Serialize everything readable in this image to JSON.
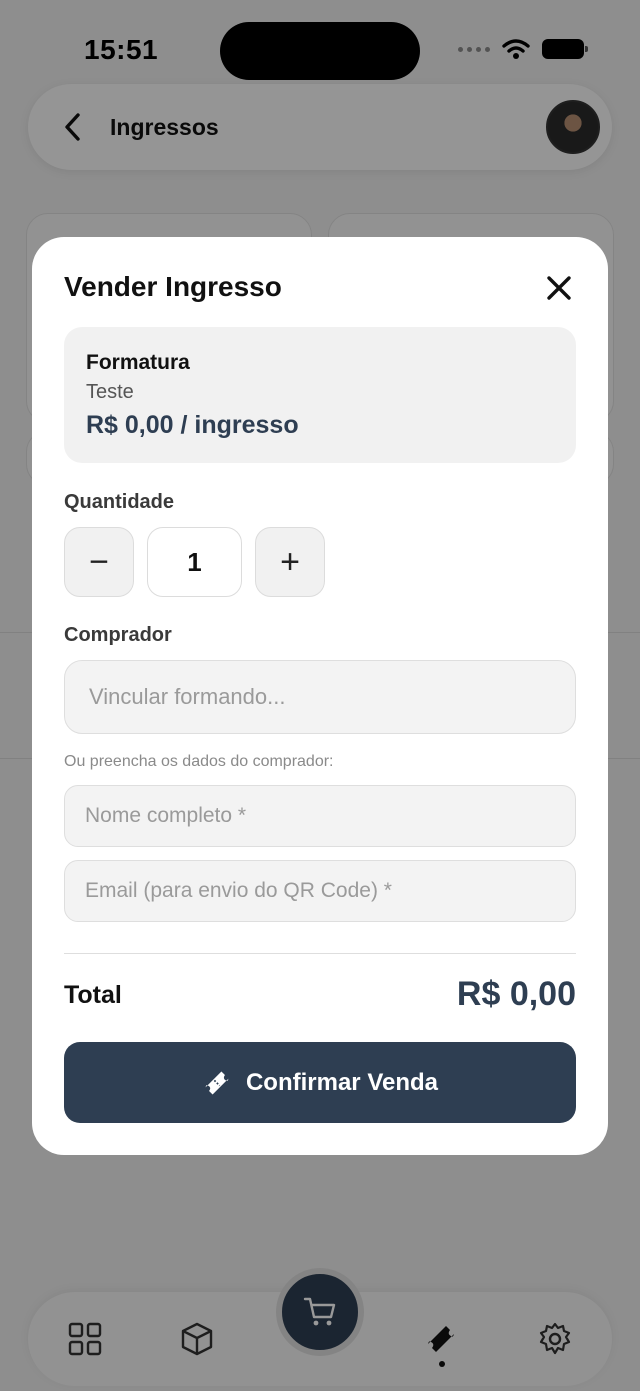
{
  "status_bar": {
    "time": "15:51"
  },
  "header": {
    "title": "Ingressos"
  },
  "modal": {
    "title": "Vender Ingresso",
    "event": {
      "name": "Formatura",
      "subtitle": "Teste",
      "price": "R$ 0,00 / ingresso"
    },
    "quantity": {
      "label": "Quantidade",
      "minus": "−",
      "value": "1",
      "plus": "+"
    },
    "buyer": {
      "label": "Comprador",
      "link_placeholder": "Vincular formando...",
      "hint": "Ou preencha os dados do comprador:",
      "name_placeholder": "Nome completo *",
      "email_placeholder": "Email (para envio do QR Code) *"
    },
    "total": {
      "label": "Total",
      "value": "R$ 0,00"
    },
    "confirm_label": "Confirmar Venda"
  },
  "bottom_nav": {
    "items": [
      "grid-icon",
      "box-icon",
      "cart-icon",
      "ticket-icon",
      "gear-icon"
    ],
    "active": "ticket-icon"
  },
  "colors": {
    "primary": "#2e3e52",
    "overlay": "rgba(0,0,0,0.4)"
  }
}
